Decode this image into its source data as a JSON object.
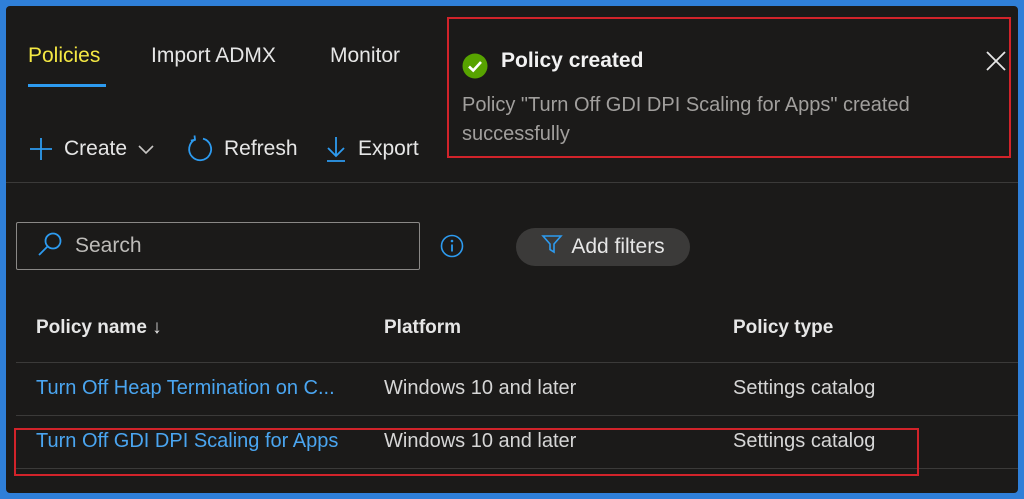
{
  "tabs": [
    {
      "label": "Policies",
      "active": true
    },
    {
      "label": "Import ADMX",
      "active": false
    },
    {
      "label": "Monitor",
      "active": false
    }
  ],
  "toolbar": {
    "create_label": "Create",
    "refresh_label": "Refresh",
    "export_label": "Export"
  },
  "search": {
    "placeholder": "Search",
    "value": ""
  },
  "filters": {
    "label": "Add filters"
  },
  "table": {
    "columns": [
      "Policy name ↓",
      "Platform",
      "Policy type"
    ],
    "rows": [
      {
        "name": "Turn Off Heap Termination on C...",
        "platform": "Windows 10 and later",
        "type": "Settings catalog"
      },
      {
        "name": "Turn Off GDI DPI Scaling for Apps",
        "platform": "Windows 10 and later",
        "type": "Settings catalog"
      }
    ]
  },
  "notification": {
    "title": "Policy created",
    "message": "Policy \"Turn Off GDI DPI Scaling for Apps\" created successfully",
    "status": "success"
  },
  "colors": {
    "accent": "#2d9bf0",
    "active_tab": "#f4e843",
    "link": "#4aa5f0",
    "success": "#57a300",
    "highlight": "#d2232a",
    "frame_border": "#2f7fd8"
  },
  "icons": {
    "create": "plus-icon",
    "create_dropdown": "chevron-down-icon",
    "refresh": "refresh-icon",
    "export": "download-icon",
    "search": "search-icon",
    "info": "info-icon",
    "filter": "filter-icon",
    "success": "checkmark-circle-icon",
    "close": "close-icon"
  }
}
